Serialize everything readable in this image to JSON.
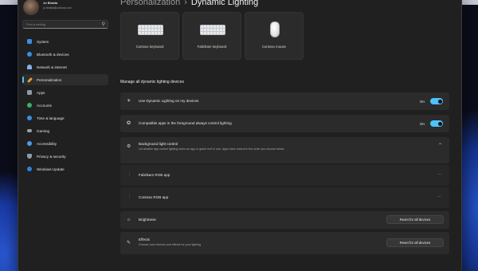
{
  "profile": {
    "name": "Jo Bhatta",
    "email": "jo.bhatta@outlook.com"
  },
  "search": {
    "placeholder": "Find a setting",
    "icon": "search-icon"
  },
  "sidebar": {
    "items": [
      {
        "label": "System",
        "icon": "system-icon",
        "color": "#3a8ee6"
      },
      {
        "label": "Bluetooth & devices",
        "icon": "bluetooth-icon",
        "color": "#3a8ee6"
      },
      {
        "label": "Network & internet",
        "icon": "network-icon",
        "color": "#7fb2e8"
      },
      {
        "label": "Personalization",
        "icon": "brush-icon",
        "color": "#e39a3b",
        "active": true
      },
      {
        "label": "Apps",
        "icon": "apps-icon",
        "color": "#8f9aa8"
      },
      {
        "label": "Accounts",
        "icon": "accounts-icon",
        "color": "#3fae6a"
      },
      {
        "label": "Time & language",
        "icon": "globe-icon",
        "color": "#3a8ee6"
      },
      {
        "label": "Gaming",
        "icon": "gaming-icon",
        "color": "#9aa0a8"
      },
      {
        "label": "Accessibility",
        "icon": "accessibility-icon",
        "color": "#4b9be8"
      },
      {
        "label": "Privacy & security",
        "icon": "shield-icon",
        "color": "#8f9aa8"
      },
      {
        "label": "Windows Update",
        "icon": "update-icon",
        "color": "#2f7fd9"
      }
    ]
  },
  "header": {
    "parent": "Personalization",
    "separator": "›",
    "current": "Dynamic Lighting"
  },
  "devices": [
    {
      "label": "Contoso keyboard",
      "icon": "keyboard-icon"
    },
    {
      "label": "Fabrikam keyboard",
      "icon": "keyboard-icon"
    },
    {
      "label": "Contoso mouse",
      "icon": "mouse-icon"
    }
  ],
  "section": {
    "manage_label": "Manage all dynamic lighting devices"
  },
  "settings": {
    "use_dynamic": {
      "title": "Use Dynamic Lighting on my devices",
      "state": "On"
    },
    "compatible_apps": {
      "title": "Compatible apps in the foreground always control lighting",
      "state": "On"
    },
    "background_control": {
      "title": "Background light control",
      "desc": "Let another app control lighting when an app or game isn't in use. Apps have control in the order you choose below"
    },
    "apps": [
      {
        "label": "Fabrikam RGB app"
      },
      {
        "label": "Contoso RGB app"
      }
    ],
    "brightness": {
      "title": "Brightness",
      "button": "Reset for all devices"
    },
    "effects": {
      "title": "Effects",
      "desc": "Choose color themes and effects for your lighting",
      "button": "Reset for all devices"
    }
  },
  "accent_color": "#4cc2ff"
}
